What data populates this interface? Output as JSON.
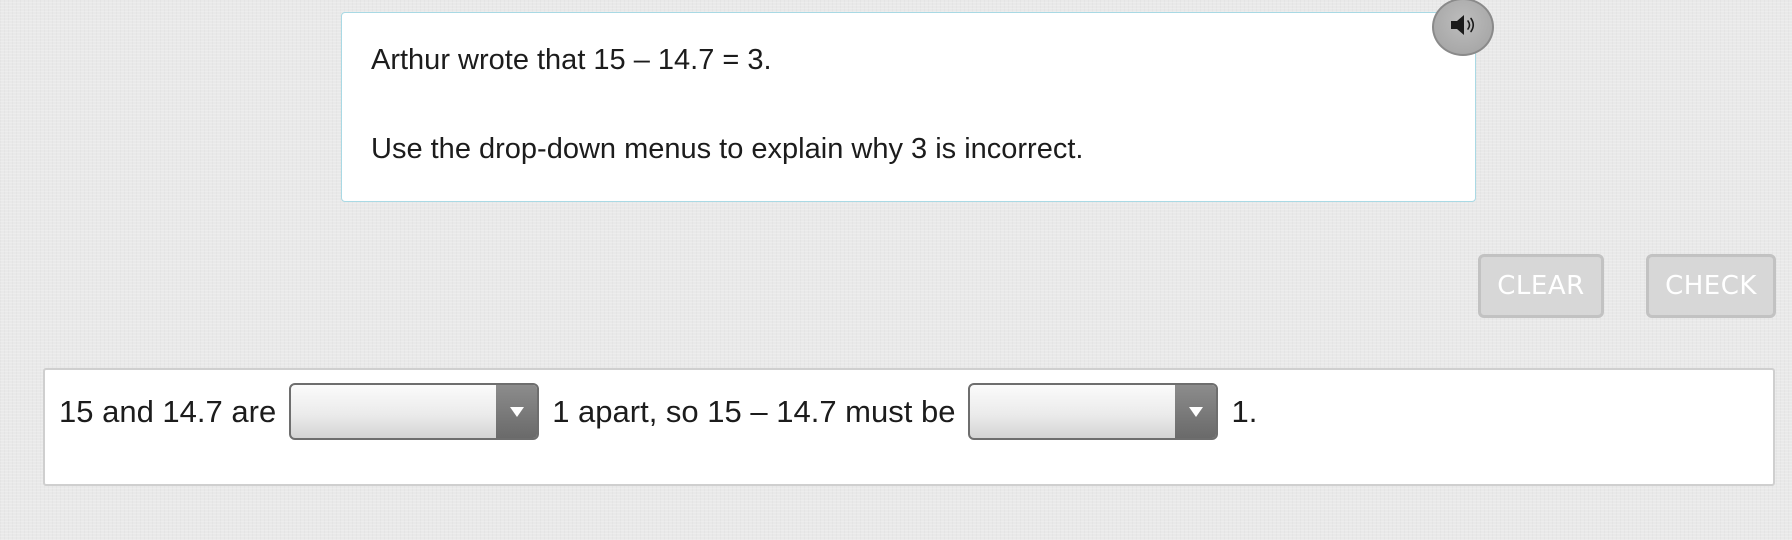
{
  "question": {
    "line_1": "Arthur wrote that 15 – 14.7 = 3.",
    "line_2": "Use the drop-down menus to explain why 3 is incorrect."
  },
  "audio_button": {
    "icon": "speaker-icon"
  },
  "actions": {
    "clear_label": "CLEAR",
    "check_label": "CHECK"
  },
  "answer": {
    "text_before_first": "15 and 14.7 are",
    "dropdown_1_value": "",
    "text_between": "1 apart, so 15 – 14.7 must be",
    "dropdown_2_value": "",
    "text_after_second": "1."
  },
  "colors": {
    "card_border": "#a9d9e4",
    "button_fill": "#d7d7d7",
    "dropdown_arrow": "#6a6a6a"
  }
}
